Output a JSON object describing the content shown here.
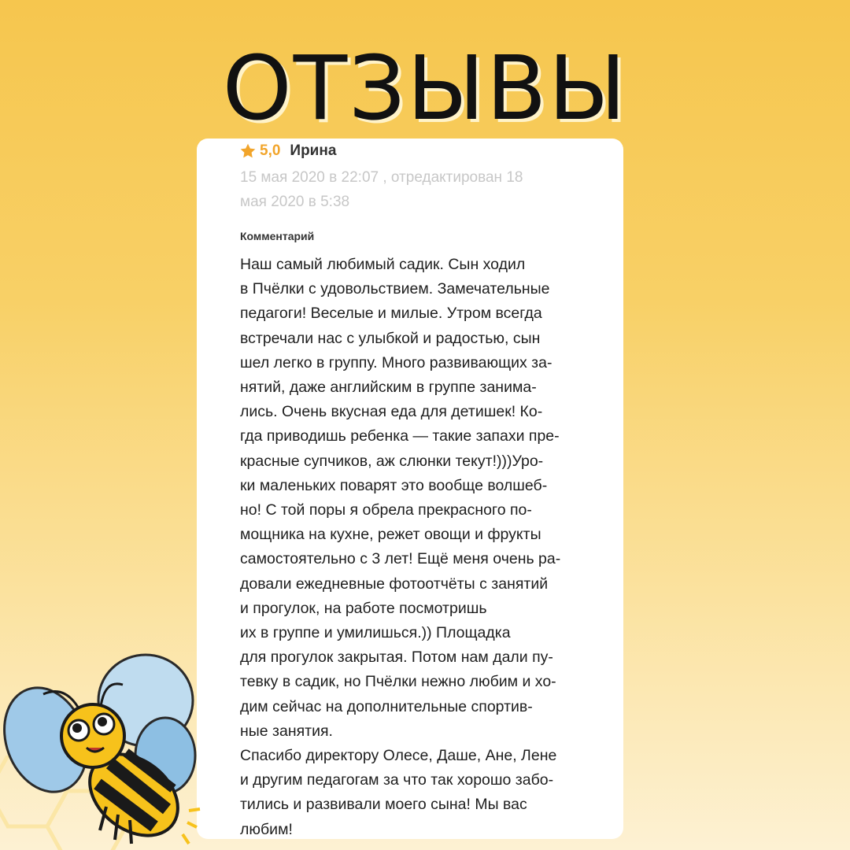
{
  "title": "ОТЗЫВЫ",
  "review": {
    "rating": "5,0",
    "author": "Ирина",
    "date_line1": "15 мая 2020 в 22:07 , отредактирован 18",
    "date_line2": "мая 2020 в 5:38",
    "comment_label": "Комментарий",
    "lines": [
      "Наш самый любимый садик. Сын ходил",
      "в Пчёлки с удовольствием. Замечательные",
      "педагоги! Веселые и милые. Утром всегда",
      "встречали нас с улыбкой и радостью, сын",
      "шел легко в группу. Много развивающих за-",
      "нятий, даже английским в группе занима-",
      "лись. Очень вкусная еда для детишек! Ко-",
      "гда приводишь ребенка — такие запахи пре-",
      "красные супчиков, аж слюнки текут!)))Уро-",
      "ки маленьких поварят это вообще волшеб-",
      "но! С той поры я обрела прекрасного по-",
      "мощника на кухне, режет овощи и фрукты",
      "самостоятельно с 3 лет! Ещё меня очень ра-",
      "довали ежедневные фотоотчёты с занятий",
      "и прогулок, на работе посмотришь",
      " их в группе и умилишься.)) Площадка",
      "для прогулок закрытая. Потом нам дали пу-",
      "тевку в садик, но Пчёлки нежно любим и хо-",
      "дим сейчас на дополнительные спортив-",
      "ные занятия.",
      "Спасибо директору Олесе, Даше, Ане, Лене",
      "и другим педагогам за что так хорошо забо-",
      "тились и развивали моего сына! Мы вас",
      "любим!"
    ]
  },
  "icons": {
    "star": "star-icon",
    "bee": "bee-mascot-icon"
  },
  "colors": {
    "star": "#f2a52b",
    "background_top": "#f6c64e",
    "background_bottom": "#fdf1d3"
  }
}
